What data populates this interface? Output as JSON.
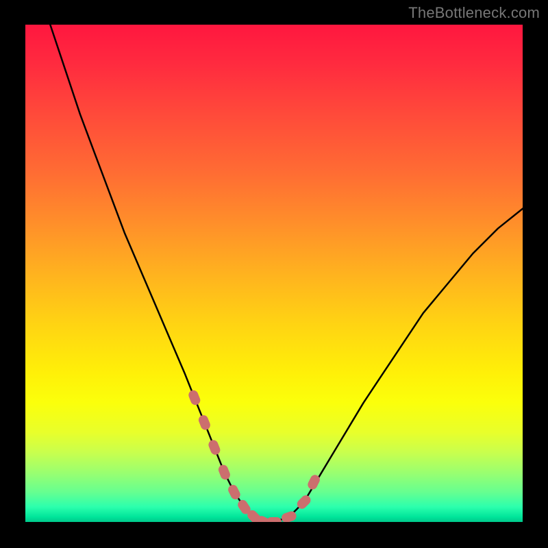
{
  "watermark": "TheBottleneck.com",
  "colors": {
    "background": "#000000",
    "curve": "#000000",
    "marker": "#cc6e6e",
    "gradient_top": "#ff173f",
    "gradient_bottom": "#00c98b"
  },
  "chart_data": {
    "type": "line",
    "title": "",
    "xlabel": "",
    "ylabel": "",
    "xlim": [
      0,
      100
    ],
    "ylim": [
      0,
      100
    ],
    "series": [
      {
        "name": "bottleneck-curve",
        "x": [
          5,
          8,
          11,
          14,
          17,
          20,
          23,
          26,
          29,
          32,
          34,
          36,
          38,
          40,
          42,
          44,
          46,
          48,
          50,
          53,
          56,
          59,
          62,
          65,
          68,
          72,
          76,
          80,
          85,
          90,
          95,
          100
        ],
        "y": [
          100,
          91,
          82,
          74,
          66,
          58,
          51,
          44,
          37,
          30,
          25,
          20,
          15,
          10,
          6,
          3,
          1,
          0,
          0,
          1,
          4,
          9,
          14,
          19,
          24,
          30,
          36,
          42,
          48,
          54,
          59,
          63
        ]
      }
    ],
    "markers": {
      "name": "highlight-points",
      "x": [
        34,
        36,
        38,
        40,
        42,
        44,
        46,
        48,
        50,
        53,
        56,
        58
      ],
      "y": [
        25,
        20,
        15,
        10,
        6,
        3,
        1,
        0,
        0,
        1,
        4,
        8
      ]
    }
  }
}
